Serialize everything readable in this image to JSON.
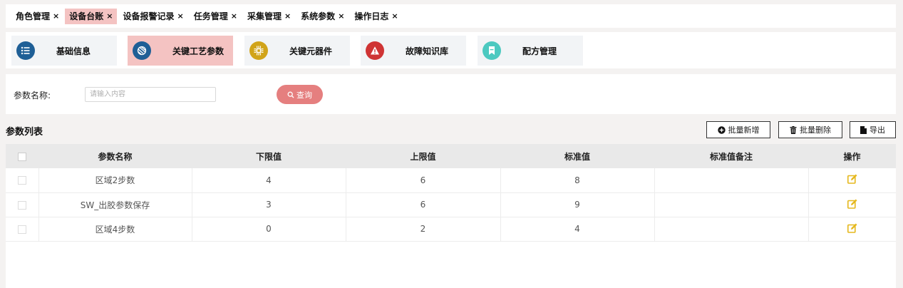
{
  "tabs": [
    {
      "label": "角色管理",
      "close": "×",
      "active": false
    },
    {
      "label": "设备台账",
      "close": "×",
      "active": true
    },
    {
      "label": "设备报警记录",
      "close": "×",
      "active": false
    },
    {
      "label": "任务管理",
      "close": "×",
      "active": false
    },
    {
      "label": "采集管理",
      "close": "×",
      "active": false
    },
    {
      "label": "系统参数",
      "close": "×",
      "active": false
    },
    {
      "label": "操作日志",
      "close": "×",
      "active": false
    }
  ],
  "cards": [
    {
      "label": "基础信息",
      "icon": "list-icon",
      "color": "#1f5f96",
      "active": false
    },
    {
      "label": "关键工艺参数",
      "icon": "globe-icon",
      "color": "#1f5f96",
      "active": true
    },
    {
      "label": "关键元器件",
      "icon": "chip-icon",
      "color": "#d1a41a",
      "active": false
    },
    {
      "label": "故障知识库",
      "icon": "warning-icon",
      "color": "#cf3434",
      "active": false
    },
    {
      "label": "配方管理",
      "icon": "bookmark-icon",
      "color": "#4cc9c0",
      "active": false
    }
  ],
  "search": {
    "label": "参数名称:",
    "placeholder": "请输入内容",
    "button": "查询"
  },
  "list": {
    "title": "参数列表",
    "batch_add": "批量新增",
    "batch_delete": "批量删除",
    "export": "导出"
  },
  "table": {
    "headers": [
      "参数名称",
      "下限值",
      "上限值",
      "标准值",
      "标准值备注",
      "操作"
    ],
    "rows": [
      {
        "name": "区域2步数",
        "lower": "4",
        "upper": "6",
        "standard": "8",
        "note": ""
      },
      {
        "name": "SW_出胶参数保存",
        "lower": "3",
        "upper": "6",
        "standard": "9",
        "note": ""
      },
      {
        "name": "区域4步数",
        "lower": "0",
        "upper": "2",
        "standard": "4",
        "note": ""
      }
    ]
  },
  "colors": {
    "accent": "#e57f7f",
    "active_bg": "#f4c3c2",
    "edit_icon": "#e5b81d"
  }
}
